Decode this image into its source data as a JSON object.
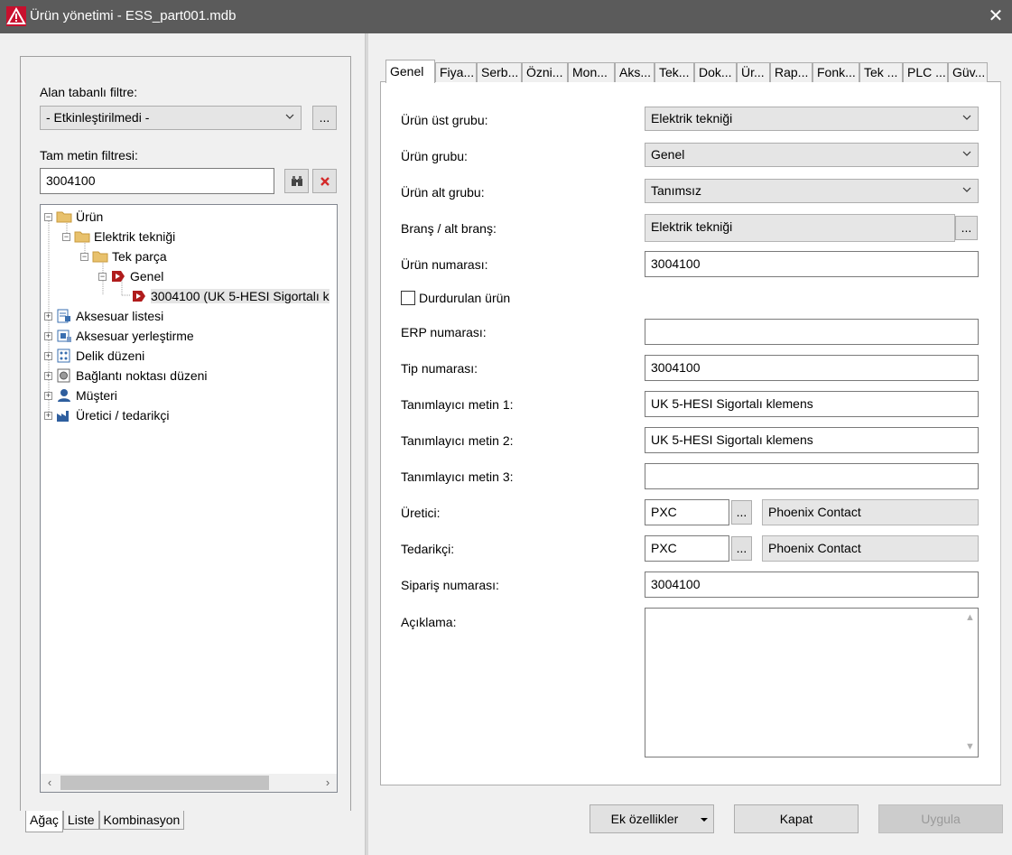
{
  "window": {
    "title": "Ürün yönetimi - ESS_part001.mdb",
    "close_glyph": "✕"
  },
  "left": {
    "field_filter_label": "Alan tabanlı filtre:",
    "field_filter_value": "- Etkinleştirilmedi -",
    "ellipsis": "...",
    "fulltext_label": "Tam metin filtresi:",
    "fulltext_value": "3004100",
    "tree": [
      {
        "label": "Ürün",
        "icon": "folder-icon"
      },
      {
        "label": "Elektrik tekniği",
        "icon": "folder-icon"
      },
      {
        "label": "Tek parça",
        "icon": "folder-icon"
      },
      {
        "label": "Genel",
        "icon": "part-icon"
      },
      {
        "label": "3004100 (UK 5-HESI Sigortalı k",
        "icon": "part-icon"
      },
      {
        "label": "Aksesuar listesi",
        "icon": "accessory-list-icon"
      },
      {
        "label": "Aksesuar yerleştirme",
        "icon": "accessory-placement-icon"
      },
      {
        "label": "Delik düzeni",
        "icon": "drilling-pattern-icon"
      },
      {
        "label": "Bağlantı noktası düzeni",
        "icon": "connection-pattern-icon"
      },
      {
        "label": "Müşteri",
        "icon": "customer-icon"
      },
      {
        "label": "Üretici / tedarikçi",
        "icon": "manufacturer-icon"
      }
    ],
    "bottom_tabs": [
      "Ağaç",
      "Liste",
      "Kombinasyon"
    ]
  },
  "tabs": [
    "Genel",
    "Fiya...",
    "Serb...",
    "Özni...",
    "Mon...",
    "Aks...",
    "Tek...",
    "Dok...",
    "Ür...",
    "Rap...",
    "Fonk...",
    "Tek ...",
    "PLC ...",
    "Güv..."
  ],
  "form": {
    "product_top_group_label": "Ürün üst grubu:",
    "product_top_group_value": "Elektrik tekniği",
    "product_group_label": "Ürün grubu:",
    "product_group_value": "Genel",
    "product_subgroup_label": "Ürün alt grubu:",
    "product_subgroup_value": "Tanımsız",
    "discipline_label": "Branş / alt branş:",
    "discipline_value": "Elektrik tekniği",
    "part_number_label": "Ürün numarası:",
    "part_number_value": "3004100",
    "discontinued_label": "Durdurulan ürün",
    "erp_label": "ERP numarası:",
    "erp_value": "",
    "type_label": "Tip numarası:",
    "type_value": "3004100",
    "desc1_label": "Tanımlayıcı metin 1:",
    "desc1_value": "UK 5-HESI Sigortalı klemens",
    "desc2_label": "Tanımlayıcı metin 2:",
    "desc2_value": "UK 5-HESI Sigortalı klemens",
    "desc3_label": "Tanımlayıcı metin 3:",
    "desc3_value": "",
    "manufacturer_label": "Üretici:",
    "manufacturer_code": "PXC",
    "manufacturer_name": "Phoenix Contact",
    "supplier_label": "Tedarikçi:",
    "supplier_code": "PXC",
    "supplier_name": "Phoenix Contact",
    "order_number_label": "Sipariş numarası:",
    "order_number_value": "3004100",
    "note_label": "Açıklama:"
  },
  "buttons": {
    "extras": "Ek özellikler",
    "close": "Kapat",
    "apply": "Uygula"
  }
}
